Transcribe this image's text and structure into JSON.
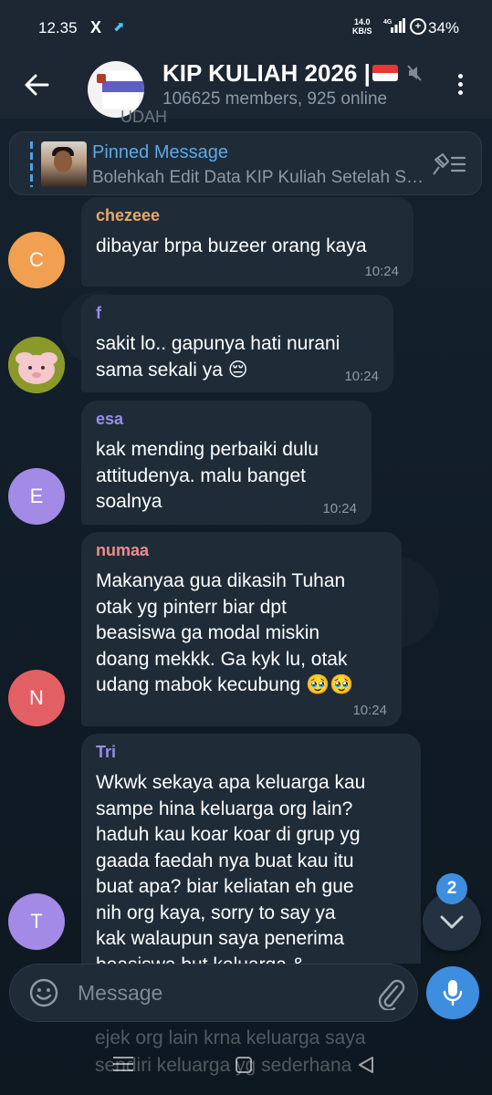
{
  "status_bar": {
    "time": "12.35",
    "x_glyph": "X",
    "app_glyph": "⬈",
    "net_speed": "14.0",
    "net_unit": "KB/S",
    "network": "4G",
    "battery_glyph": "+",
    "battery": "34%"
  },
  "header": {
    "title": "KIP KULIAH 2026 |",
    "subtitle": "106625 members, 925 online"
  },
  "partial_top_text": "UDAH",
  "pinned": {
    "title": "Pinned Message",
    "text": "Bolehkah Edit Data KIP Kuliah Setelah Submit?"
  },
  "messages": [
    {
      "sender": "chezeee",
      "initial": "C",
      "text": "dibayar brpa buzeer orang kaya",
      "time": "10:24",
      "sender_color": "#e8a86a",
      "avatar_color": "#f0a050"
    },
    {
      "sender": "f",
      "initial": "",
      "text": "sakit lo.. gapunya hati nurani\nsama sekali ya 😔",
      "time": "10:24",
      "sender_color": "#9a8de8"
    },
    {
      "sender": "esa",
      "initial": "E",
      "text": "kak mending perbaiki dulu\nattitudenya. malu banget\nsoalnya",
      "time": "10:24",
      "sender_color": "#9a8de8",
      "avatar_color": "#a28ae6"
    },
    {
      "sender": "numaa",
      "initial": "N",
      "text": "Makanyaa gua dikasih Tuhan\notak yg pinterr biar dpt\nbeasiswa ga modal miskin\ndoang mekkk. Ga kyk lu, otak\nudang mabok kecubung 🥹🥹",
      "time": "10:24",
      "sender_color": "#f08a8a",
      "avatar_color": "#e25f63"
    },
    {
      "sender": "Tri",
      "initial": "T",
      "text": "Wkwk sekaya apa keluarga kau\nsampe hina keluarga org lain?\nhaduh kau koar koar di grup yg\ngaada faedah nya buat kau itu\nbuat apa? biar keliatan eh gue\nnih org kaya, sorry to say ya\nkak walaupun saya penerima\nbeasiswa but keluarga &",
      "sender_color": "#9a8de8",
      "avatar_color": "#a28ae6"
    }
  ],
  "behind_input_lines": [
    "ejek org lain krna keluarga saya",
    "sendiri keluarga yg sederhana"
  ],
  "scroll_badge": "2",
  "input": {
    "placeholder": "Message"
  }
}
